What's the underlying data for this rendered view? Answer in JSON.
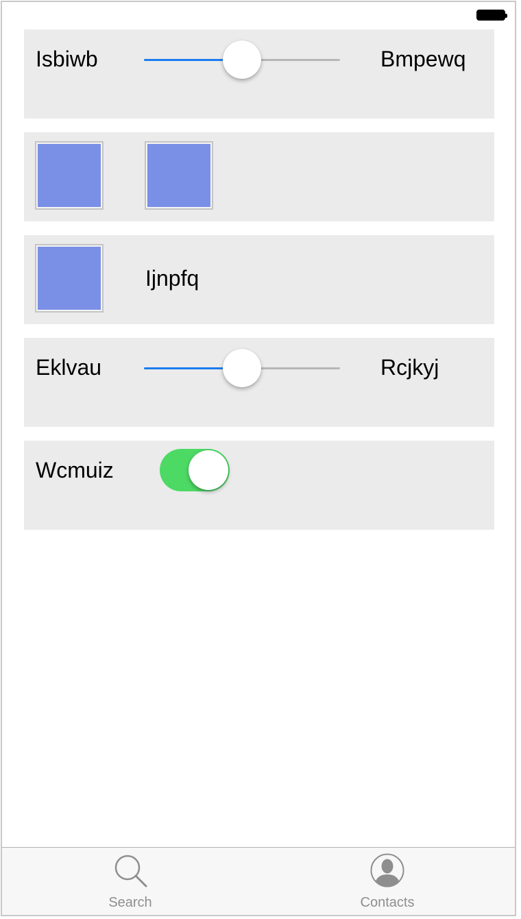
{
  "rows": {
    "slider_1": {
      "left_label": "Isbiwb",
      "right_label": "Bmpewq",
      "value": 0.5
    },
    "image_pair": {
      "swatch_color": "#7a8fe6"
    },
    "image_label": {
      "label": "Ijnpfq",
      "swatch_color": "#7a8fe6"
    },
    "slider_2": {
      "left_label": "Eklvau",
      "right_label": "Rcjkyj",
      "value": 0.5
    },
    "switch": {
      "label": "Wcmuiz",
      "on": true,
      "on_color": "#4cd964"
    }
  },
  "colors": {
    "slider_fill": "#1a7cf0",
    "row_background": "#ebebeb"
  },
  "tab_bar": {
    "tabs": [
      {
        "label": "Search",
        "icon": "search-icon"
      },
      {
        "label": "Contacts",
        "icon": "contacts-icon"
      }
    ]
  }
}
